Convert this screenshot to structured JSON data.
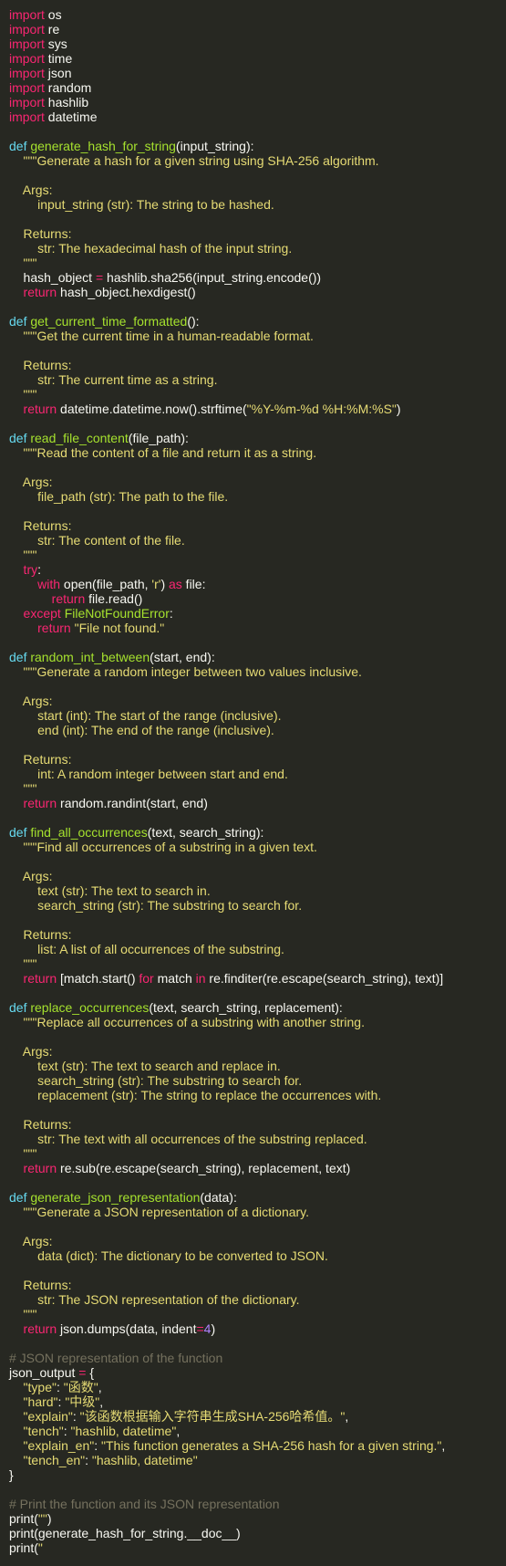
{
  "editor": {
    "language": "python",
    "theme": "monokai",
    "colors": {
      "background": "#272822",
      "text": "#f8f8f2",
      "keyword": "#f92672",
      "function": "#a6e22e",
      "builtin": "#66d9ef",
      "string": "#e6db74",
      "number": "#ae81ff",
      "comment": "#75715e"
    },
    "lines": [
      [
        [
          "kw",
          "import"
        ],
        [
          "pl",
          " os"
        ]
      ],
      [
        [
          "kw",
          "import"
        ],
        [
          "pl",
          " re"
        ]
      ],
      [
        [
          "kw",
          "import"
        ],
        [
          "pl",
          " sys"
        ]
      ],
      [
        [
          "kw",
          "import"
        ],
        [
          "pl",
          " time"
        ]
      ],
      [
        [
          "kw",
          "import"
        ],
        [
          "pl",
          " json"
        ]
      ],
      [
        [
          "kw",
          "import"
        ],
        [
          "pl",
          " random"
        ]
      ],
      [
        [
          "kw",
          "import"
        ],
        [
          "pl",
          " hashlib"
        ]
      ],
      [
        [
          "kw",
          "import"
        ],
        [
          "pl",
          " datetime"
        ]
      ],
      [],
      [
        [
          "bi",
          "def "
        ],
        [
          "fn",
          "generate_hash_for_string"
        ],
        [
          "pl",
          "(input_string):"
        ]
      ],
      [
        [
          "str",
          "    \"\"\"Generate a hash for a given string using SHA-256 algorithm."
        ]
      ],
      [],
      [
        [
          "str",
          "    Args:"
        ]
      ],
      [
        [
          "str",
          "        input_string (str): The string to be hashed."
        ]
      ],
      [],
      [
        [
          "str",
          "    Returns:"
        ]
      ],
      [
        [
          "str",
          "        str: The hexadecimal hash of the input string."
        ]
      ],
      [
        [
          "str",
          "    \"\"\""
        ]
      ],
      [
        [
          "pl",
          "    hash_object "
        ],
        [
          "kw",
          "="
        ],
        [
          "pl",
          " hashlib.sha256(input_string.encode())"
        ]
      ],
      [
        [
          "kw",
          "    return"
        ],
        [
          "pl",
          " hash_object.hexdigest()"
        ]
      ],
      [],
      [
        [
          "bi",
          "def "
        ],
        [
          "fn",
          "get_current_time_formatted"
        ],
        [
          "pl",
          "():"
        ]
      ],
      [
        [
          "str",
          "    \"\"\"Get the current time in a human-readable format."
        ]
      ],
      [],
      [
        [
          "str",
          "    Returns:"
        ]
      ],
      [
        [
          "str",
          "        str: The current time as a string."
        ]
      ],
      [
        [
          "str",
          "    \"\"\""
        ]
      ],
      [
        [
          "kw",
          "    return"
        ],
        [
          "pl",
          " datetime.datetime.now().strftime("
        ],
        [
          "str",
          "\"%Y-%m-%d %H:%M:%S\""
        ],
        [
          "pl",
          ")"
        ]
      ],
      [],
      [
        [
          "bi",
          "def "
        ],
        [
          "fn",
          "read_file_content"
        ],
        [
          "pl",
          "(file_path):"
        ]
      ],
      [
        [
          "str",
          "    \"\"\"Read the content of a file and return it as a string."
        ]
      ],
      [],
      [
        [
          "str",
          "    Args:"
        ]
      ],
      [
        [
          "str",
          "        file_path (str): The path to the file."
        ]
      ],
      [],
      [
        [
          "str",
          "    Returns:"
        ]
      ],
      [
        [
          "str",
          "        str: The content of the file."
        ]
      ],
      [
        [
          "str",
          "    \"\"\""
        ]
      ],
      [
        [
          "kw",
          "    try"
        ],
        [
          "pl",
          ":"
        ]
      ],
      [
        [
          "kw",
          "        with"
        ],
        [
          "pl",
          " open(file_path, "
        ],
        [
          "str",
          "'r'"
        ],
        [
          "pl",
          ") "
        ],
        [
          "kw",
          "as"
        ],
        [
          "pl",
          " file:"
        ]
      ],
      [
        [
          "kw",
          "            return"
        ],
        [
          "pl",
          " file.read()"
        ]
      ],
      [
        [
          "kw",
          "    except "
        ],
        [
          "fn",
          "FileNotFoundError"
        ],
        [
          "pl",
          ":"
        ]
      ],
      [
        [
          "kw",
          "        return "
        ],
        [
          "str",
          "\"File not found.\""
        ]
      ],
      [],
      [
        [
          "bi",
          "def "
        ],
        [
          "fn",
          "random_int_between"
        ],
        [
          "pl",
          "(start, end):"
        ]
      ],
      [
        [
          "str",
          "    \"\"\"Generate a random integer between two values inclusive."
        ]
      ],
      [],
      [
        [
          "str",
          "    Args:"
        ]
      ],
      [
        [
          "str",
          "        start (int): The start of the range (inclusive)."
        ]
      ],
      [
        [
          "str",
          "        end (int): The end of the range (inclusive)."
        ]
      ],
      [],
      [
        [
          "str",
          "    Returns:"
        ]
      ],
      [
        [
          "str",
          "        int: A random integer between start and end."
        ]
      ],
      [
        [
          "str",
          "    \"\"\""
        ]
      ],
      [
        [
          "kw",
          "    return"
        ],
        [
          "pl",
          " random.randint(start, end)"
        ]
      ],
      [],
      [
        [
          "bi",
          "def "
        ],
        [
          "fn",
          "find_all_occurrences"
        ],
        [
          "pl",
          "(text, search_string):"
        ]
      ],
      [
        [
          "str",
          "    \"\"\"Find all occurrences of a substring in a given text."
        ]
      ],
      [],
      [
        [
          "str",
          "    Args:"
        ]
      ],
      [
        [
          "str",
          "        text (str): The text to search in."
        ]
      ],
      [
        [
          "str",
          "        search_string (str): The substring to search for."
        ]
      ],
      [],
      [
        [
          "str",
          "    Returns:"
        ]
      ],
      [
        [
          "str",
          "        list: A list of all occurrences of the substring."
        ]
      ],
      [
        [
          "str",
          "    \"\"\""
        ]
      ],
      [
        [
          "kw",
          "    return"
        ],
        [
          "pl",
          " [match.start() "
        ],
        [
          "kw",
          "for"
        ],
        [
          "pl",
          " match "
        ],
        [
          "kw",
          "in"
        ],
        [
          "pl",
          " re.finditer(re.escape(search_string), text)]"
        ]
      ],
      [],
      [
        [
          "bi",
          "def "
        ],
        [
          "fn",
          "replace_occurrences"
        ],
        [
          "pl",
          "(text, search_string, replacement):"
        ]
      ],
      [
        [
          "str",
          "    \"\"\"Replace all occurrences of a substring with another string."
        ]
      ],
      [],
      [
        [
          "str",
          "    Args:"
        ]
      ],
      [
        [
          "str",
          "        text (str): The text to search and replace in."
        ]
      ],
      [
        [
          "str",
          "        search_string (str): The substring to search for."
        ]
      ],
      [
        [
          "str",
          "        replacement (str): The string to replace the occurrences with."
        ]
      ],
      [],
      [
        [
          "str",
          "    Returns:"
        ]
      ],
      [
        [
          "str",
          "        str: The text with all occurrences of the substring replaced."
        ]
      ],
      [
        [
          "str",
          "    \"\"\""
        ]
      ],
      [
        [
          "kw",
          "    return"
        ],
        [
          "pl",
          " re.sub(re.escape(search_string), replacement, text)"
        ]
      ],
      [],
      [
        [
          "bi",
          "def "
        ],
        [
          "fn",
          "generate_json_representation"
        ],
        [
          "pl",
          "(data):"
        ]
      ],
      [
        [
          "str",
          "    \"\"\"Generate a JSON representation of a dictionary."
        ]
      ],
      [],
      [
        [
          "str",
          "    Args:"
        ]
      ],
      [
        [
          "str",
          "        data (dict): The dictionary to be converted to JSON."
        ]
      ],
      [],
      [
        [
          "str",
          "    Returns:"
        ]
      ],
      [
        [
          "str",
          "        str: The JSON representation of the dictionary."
        ]
      ],
      [
        [
          "str",
          "    \"\"\""
        ]
      ],
      [
        [
          "kw",
          "    return"
        ],
        [
          "pl",
          " json.dumps(data, indent"
        ],
        [
          "kw",
          "="
        ],
        [
          "num",
          "4"
        ],
        [
          "pl",
          ")"
        ]
      ],
      [],
      [
        [
          "cm",
          "# JSON representation of the function"
        ]
      ],
      [
        [
          "pl",
          "json_output "
        ],
        [
          "kw",
          "="
        ],
        [
          "pl",
          " {"
        ]
      ],
      [
        [
          "str",
          "    \"type\""
        ],
        [
          "pl",
          ": "
        ],
        [
          "str",
          "\"函数\""
        ],
        [
          "pl",
          ","
        ]
      ],
      [
        [
          "str",
          "    \"hard\""
        ],
        [
          "pl",
          ": "
        ],
        [
          "str",
          "\"中级\""
        ],
        [
          "pl",
          ","
        ]
      ],
      [
        [
          "str",
          "    \"explain\""
        ],
        [
          "pl",
          ": "
        ],
        [
          "str",
          "\"该函数根据输入字符串生成SHA-256哈希值。\""
        ],
        [
          "pl",
          ","
        ]
      ],
      [
        [
          "str",
          "    \"tench\""
        ],
        [
          "pl",
          ": "
        ],
        [
          "str",
          "\"hashlib, datetime\""
        ],
        [
          "pl",
          ","
        ]
      ],
      [
        [
          "str",
          "    \"explain_en\""
        ],
        [
          "pl",
          ": "
        ],
        [
          "str",
          "\"This function generates a SHA-256 hash for a given string.\""
        ],
        [
          "pl",
          ","
        ]
      ],
      [
        [
          "str",
          "    \"tench_en\""
        ],
        [
          "pl",
          ": "
        ],
        [
          "str",
          "\"hashlib, datetime\""
        ]
      ],
      [
        [
          "pl",
          "}"
        ]
      ],
      [],
      [
        [
          "cm",
          "# Print the function and its JSON representation"
        ]
      ],
      [
        [
          "pl",
          "print("
        ],
        [
          "str",
          "\"\""
        ],
        [
          "pl",
          ")"
        ]
      ],
      [
        [
          "pl",
          "print(generate_hash_for_string.__doc__)"
        ]
      ],
      [
        [
          "pl",
          "print("
        ],
        [
          "str",
          "\""
        ]
      ]
    ]
  }
}
